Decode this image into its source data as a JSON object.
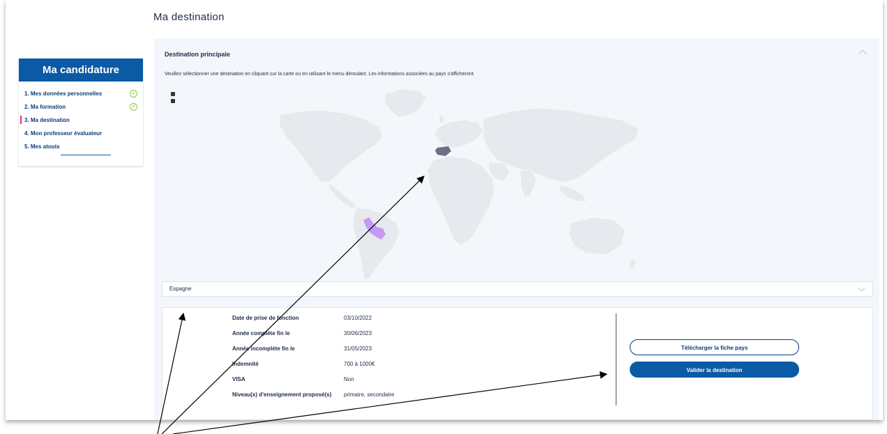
{
  "page": {
    "title": "Ma destination"
  },
  "sidebar": {
    "header": "Ma candidature",
    "steps": [
      {
        "label": "1. Mes données personnelles",
        "completed": true
      },
      {
        "label": "2. Ma formation",
        "completed": true
      },
      {
        "label": "3. Ma destination",
        "active": true
      },
      {
        "label": "4. Mon professeur évaluateur"
      },
      {
        "label": "5. Mes atouts"
      }
    ],
    "check_symbol": "✓"
  },
  "destination": {
    "section_title": "Destination principale",
    "instructions": "Veuillez sélectionner une destination en cliquant sur la carte ou en utilisant le menu déroulant. Les informations associées au pays s'afficheront.",
    "selected_country": "Espagne",
    "map_colors": {
      "base": "#e6e9ed",
      "selected": "#6f6f84",
      "highlighted": "#c49af2"
    }
  },
  "info": {
    "rows": [
      {
        "label": "Date de prise de fonction",
        "value": "03/10/2022"
      },
      {
        "label": "Année complète fin le",
        "value": "30/06/2023"
      },
      {
        "label": "Année incomplète fin le",
        "value": "31/05/2023"
      },
      {
        "label": "Indemnité",
        "value": "700 à 1000€"
      },
      {
        "label": "VISA",
        "value": "Non"
      },
      {
        "label": "Niveau(x) d'enseignement proposé(s)",
        "value": "primaire, secondaire"
      }
    ]
  },
  "actions": {
    "download_label": "Télécharger la fiche pays",
    "validate_label": "Valider la destination"
  },
  "colors": {
    "primary": "#0b5aa5",
    "active_marker": "#e0336a",
    "check": "#8cc63f"
  }
}
